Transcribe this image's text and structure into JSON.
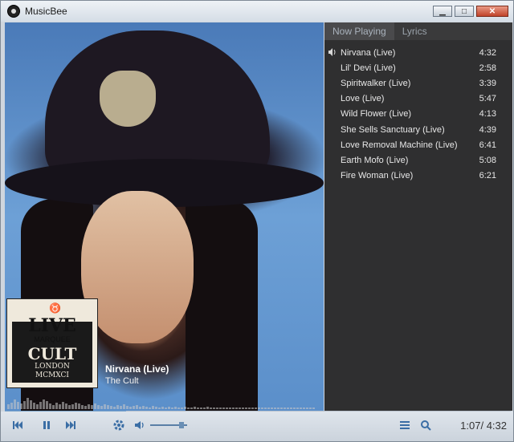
{
  "window": {
    "title": "MusicBee",
    "min_label": "▁",
    "max_label": "□",
    "close_label": "✕"
  },
  "tabs": [
    {
      "label": "Now Playing"
    },
    {
      "label": "Lyrics"
    }
  ],
  "playlist": [
    {
      "title": "Nirvana (Live)",
      "duration": "4:32",
      "playing": true
    },
    {
      "title": "Lil' Devi (Live)",
      "duration": "2:58"
    },
    {
      "title": "Spiritwalker (Live)",
      "duration": "3:39"
    },
    {
      "title": "Love (Live)",
      "duration": "5:47"
    },
    {
      "title": "Wild Flower (Live)",
      "duration": "4:13"
    },
    {
      "title": "She Sells Sanctuary (Live)",
      "duration": "4:39"
    },
    {
      "title": "Love Removal Machine (Live)",
      "duration": "6:41"
    },
    {
      "title": "Earth Mofo (Live)",
      "duration": "5:08"
    },
    {
      "title": "Fire Woman (Live)",
      "duration": "6:21"
    }
  ],
  "now_playing": {
    "title": "Nirvana (Live)",
    "artist": "The Cult"
  },
  "album_cover": {
    "line1": "LIVE",
    "line2": "MARQUEE",
    "line3": "CULT",
    "line4": "LONDON",
    "line5": "MCMXCI",
    "symbol": "♉"
  },
  "player": {
    "time": "1:07/ 4:32",
    "progress_fraction": 0.24,
    "volume_fraction": 0.85
  },
  "colors": {
    "accent": "#3b6ea5",
    "panel_bg": "#2f2f30"
  }
}
